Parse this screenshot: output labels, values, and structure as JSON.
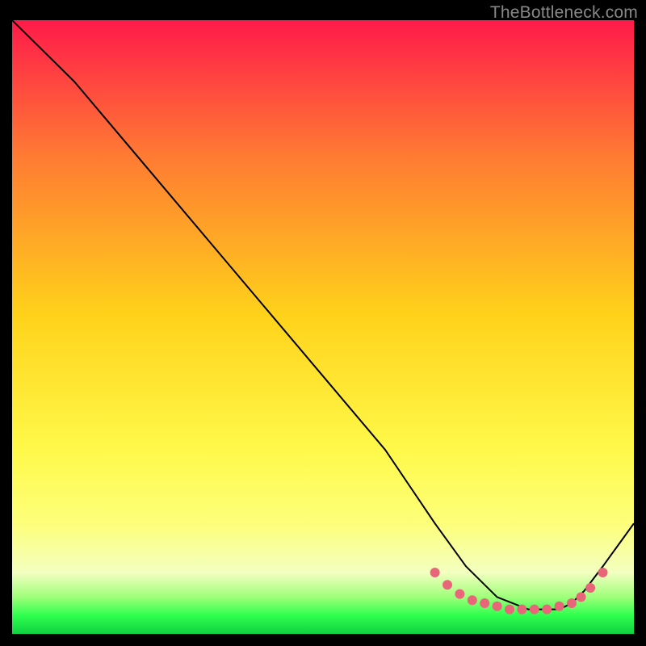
{
  "watermark": "TheBottleneck.com",
  "colors": {
    "gradient_top": "#ff1a4a",
    "gradient_upper_mid": "#ff7a33",
    "gradient_mid": "#ffd21a",
    "gradient_lower_mid": "#fff94a",
    "gradient_low": "#fdff7a",
    "gradient_pale": "#f3ffc0",
    "gradient_green_light": "#9fff7a",
    "gradient_green": "#2eff4e",
    "gradient_green_deep": "#10d040",
    "curve_stroke": "#000000",
    "dot_fill": "#e9667a",
    "frame_bg": "#000000"
  },
  "chart_data": {
    "type": "line",
    "title": "",
    "xlabel": "",
    "ylabel": "",
    "xlim": [
      0,
      100
    ],
    "ylim": [
      0,
      100
    ],
    "series": [
      {
        "name": "bottleneck-curve",
        "x": [
          0,
          7,
          10,
          20,
          30,
          40,
          50,
          60,
          68,
          73,
          78,
          83,
          88,
          90,
          92,
          95,
          100
        ],
        "y": [
          100,
          93,
          90,
          78,
          66,
          54,
          42,
          30,
          18,
          11,
          6,
          4,
          4,
          5,
          7,
          11,
          18
        ]
      }
    ],
    "highlight_dots": {
      "name": "sweet-spot-dots",
      "x": [
        68,
        70,
        72,
        74,
        76,
        78,
        80,
        82,
        84,
        86,
        88,
        90,
        91.5,
        93,
        95
      ],
      "y": [
        10,
        8,
        6.5,
        5.5,
        5,
        4.5,
        4,
        4,
        4,
        4,
        4.5,
        5,
        6,
        7.5,
        10
      ]
    }
  }
}
